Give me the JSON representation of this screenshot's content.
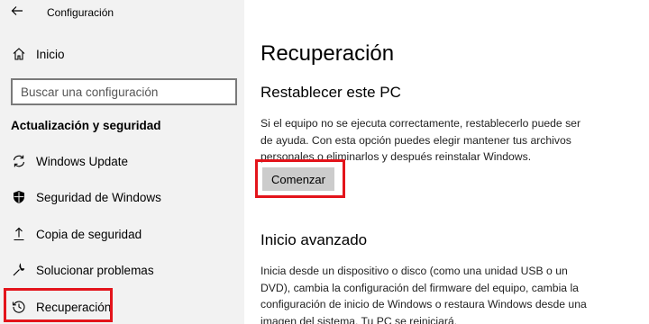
{
  "app": {
    "title": "Configuración"
  },
  "sidebar": {
    "home": "Inicio",
    "search_placeholder": "Buscar una configuración",
    "section": "Actualización y seguridad",
    "items": [
      {
        "label": "Windows Update",
        "icon": "sync-icon"
      },
      {
        "label": "Seguridad de Windows",
        "icon": "shield-icon"
      },
      {
        "label": "Copia de seguridad",
        "icon": "backup-arrow-icon"
      },
      {
        "label": "Solucionar problemas",
        "icon": "wrench-icon"
      },
      {
        "label": "Recuperación",
        "icon": "history-icon",
        "selected": true
      }
    ]
  },
  "main": {
    "title": "Recuperación",
    "reset": {
      "heading": "Restablecer este PC",
      "lines": [
        "Si el equipo no se ejecuta correctamente, restablecerlo puede ser",
        "de ayuda. Con esta opción puedes elegir mantener tus archivos",
        "personales o eliminarlos y después reinstalar Windows."
      ],
      "button": "Comenzar"
    },
    "advanced": {
      "heading": "Inicio avanzado",
      "lines": [
        "Inicia desde un dispositivo o disco (como una unidad USB o un",
        "DVD), cambia la configuración del firmware del equipo, cambia la",
        "configuración de inicio de Windows o restaura Windows desde una",
        "imagen del sistema. Tu PC se reiniciará."
      ]
    }
  },
  "colors": {
    "highlight": "#e3141b",
    "sidebar_bg": "#f2f2f2",
    "button_bg": "#cccccc"
  }
}
